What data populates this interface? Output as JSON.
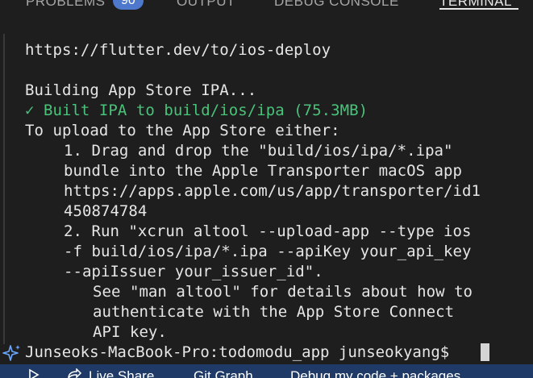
{
  "panel_tabs": {
    "problems": "PROBLEMS",
    "problems_count": "90",
    "output": "OUTPUT",
    "debug_console": "DEBUG CONSOLE",
    "terminal": "TERMINAL"
  },
  "terminal": {
    "lines": [
      "https://flutter.dev/to/ios-deploy",
      "",
      "Building App Store IPA...",
      "✓ Built IPA to build/ios/ipa (75.3MB)",
      "To upload to the App Store either:",
      "1. Drag and drop the \"build/ios/ipa/*.ipa\"",
      "bundle into the Apple Transporter macOS app",
      "https://apps.apple.com/us/app/transporter/id1",
      "450874784",
      "2. Run \"xcrun altool --upload-app --type ios",
      "-f build/ios/ipa/*.ipa --apiKey your_api_key",
      "--apiIssuer your_issuer_id\".",
      "See \"man altool\" for details about how to",
      "authenticate with the App Store Connect",
      "API key."
    ],
    "prompt": "Junseoks-MacBook-Pro:todomodu_app junseokyang$ "
  },
  "statusbar": {
    "live_share": "Live Share",
    "git_graph": "Git Graph",
    "debug": "Debug my code + packages"
  },
  "colors": {
    "background": "#1e1e1e",
    "success_green": "#49c37a",
    "statusbar": "#1f3a66",
    "badge": "#4d78cc"
  }
}
